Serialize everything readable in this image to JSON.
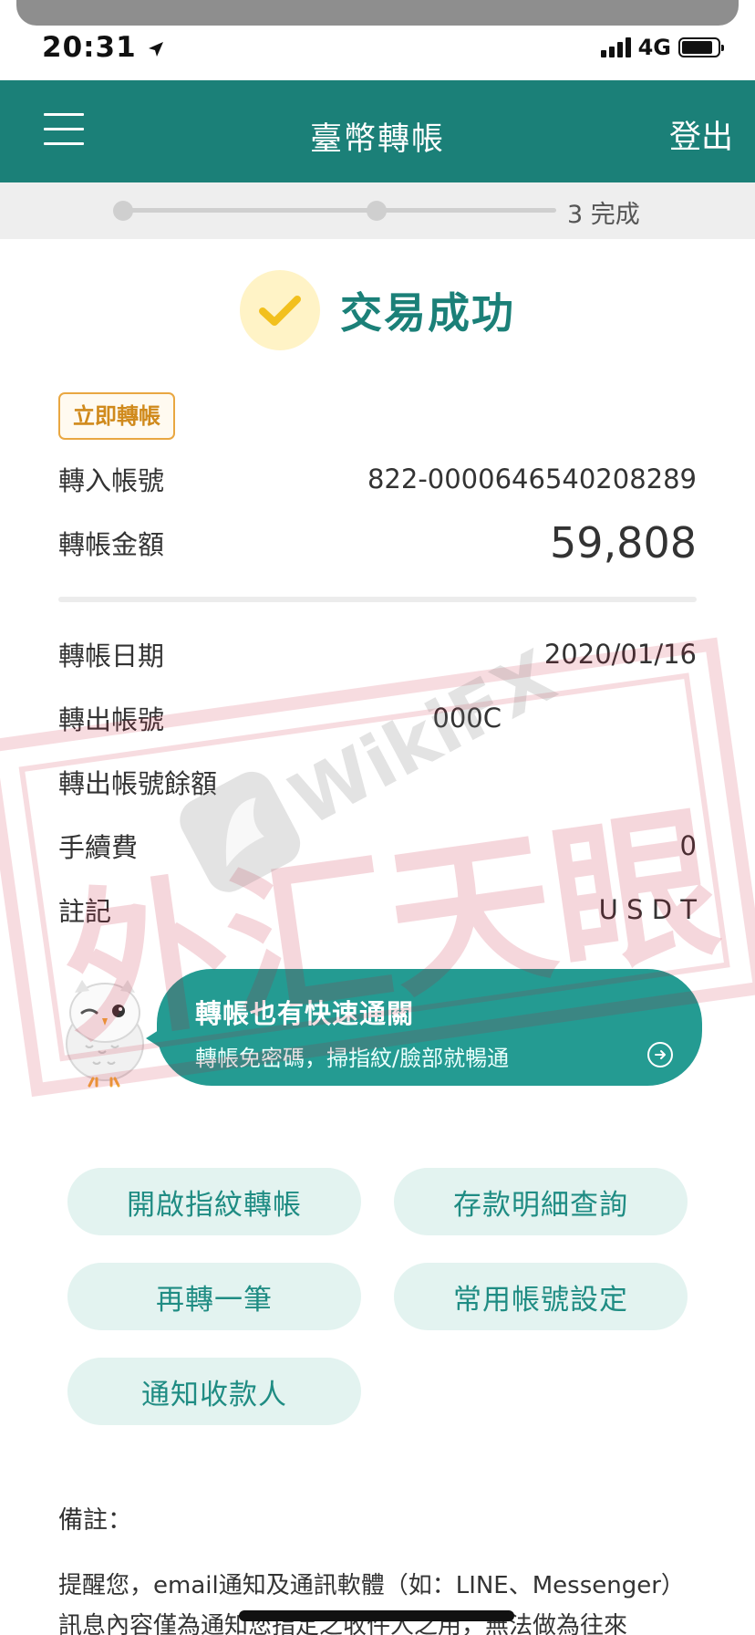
{
  "status_bar": {
    "time": "20:31",
    "network": "4G"
  },
  "header": {
    "title": "臺幣轉帳",
    "logout_label": "登出"
  },
  "progress": {
    "label": "3 完成"
  },
  "result": {
    "text": "交易成功"
  },
  "badge": {
    "text": "立即轉帳"
  },
  "transfer": {
    "to_account_label": "轉入帳號",
    "to_account_value": "822-0000646540208289",
    "amount_label": "轉帳金額",
    "amount_value": "59,808"
  },
  "details": [
    {
      "label": "轉帳日期",
      "value": "2020/01/16"
    },
    {
      "label": "轉出帳號",
      "value": "000C"
    },
    {
      "label": "轉出帳號餘額",
      "value": ""
    },
    {
      "label": "手續費",
      "value": "0"
    },
    {
      "label": "註記",
      "value": "U S D T"
    }
  ],
  "promo": {
    "title": "轉帳也有快速通關",
    "subtitle": "轉帳免密碼，掃指紋/臉部就暢通"
  },
  "actions": {
    "fingerprint": "開啟指紋轉帳",
    "deposit_query": "存款明細查詢",
    "transfer_again": "再轉一筆",
    "common_accounts": "常用帳號設定",
    "notify_payee": "通知收款人"
  },
  "notes": {
    "title": "備註：",
    "text": "提醒您，email通知及通訊軟體（如：LINE、Messenger）訊息內容僅為通知您指定之收件人之用，無法做為往來"
  },
  "watermark": {
    "text": "WikiFX",
    "seal": "外汇天眼"
  },
  "colors": {
    "brand": "#1b8078",
    "accent": "#249b92",
    "badge": "#e9a741",
    "check": "#f2c01e",
    "button_bg": "#e3f3f0"
  }
}
